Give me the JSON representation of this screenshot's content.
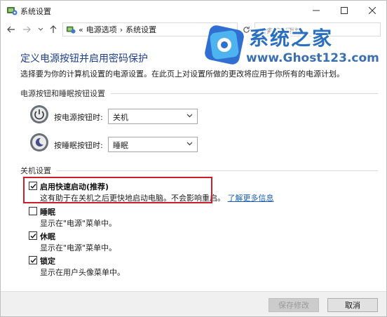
{
  "window": {
    "title": "系统设置",
    "controls": {
      "minimize": "minimize-icon",
      "maximize": "maximize-icon",
      "close": "close-icon"
    }
  },
  "nav": {
    "breadcrumb_prefix": "«",
    "breadcrumb": [
      "电源选项",
      "系统设置"
    ],
    "separator": "›",
    "search_placeholder": "搜索控制面板"
  },
  "watermark": {
    "brand": "系统之家",
    "url": "www.Ghost123.com"
  },
  "page": {
    "title": "定义电源按钮并启用密码保护",
    "description": "选择要为你的计算机设置的电源设置。在此页上对设置所做的更改将应用于你所有的电源计划。"
  },
  "power_section": {
    "heading": "电源按钮和睡眠按钮设置",
    "rows": [
      {
        "label": "按电源按钮时:",
        "value": "关机",
        "icon": "power-button-icon"
      },
      {
        "label": "按睡眠按钮时:",
        "value": "睡眠",
        "icon": "sleep-button-icon"
      }
    ]
  },
  "shutdown_section": {
    "heading": "关机设置",
    "items": [
      {
        "label": "启用快速启动(推荐)",
        "checked": true,
        "desc": "这有助于在关机之后更快地启动电脑。不会影响重启。",
        "link": "了解更多信息"
      },
      {
        "label": "睡眠",
        "checked": false,
        "desc": "显示在\"电源\"菜单中。"
      },
      {
        "label": "休眠",
        "checked": true,
        "desc": "显示在\"电源\"菜单中。"
      },
      {
        "label": "锁定",
        "checked": true,
        "desc": "显示在用户头像菜单中。"
      }
    ]
  },
  "footer": {
    "save_label": "保存修改",
    "cancel_label": "取消"
  },
  "colors": {
    "title_blue": "#1e3e8c",
    "link_blue": "#1a5fb4",
    "highlight_red": "#c9202a"
  }
}
